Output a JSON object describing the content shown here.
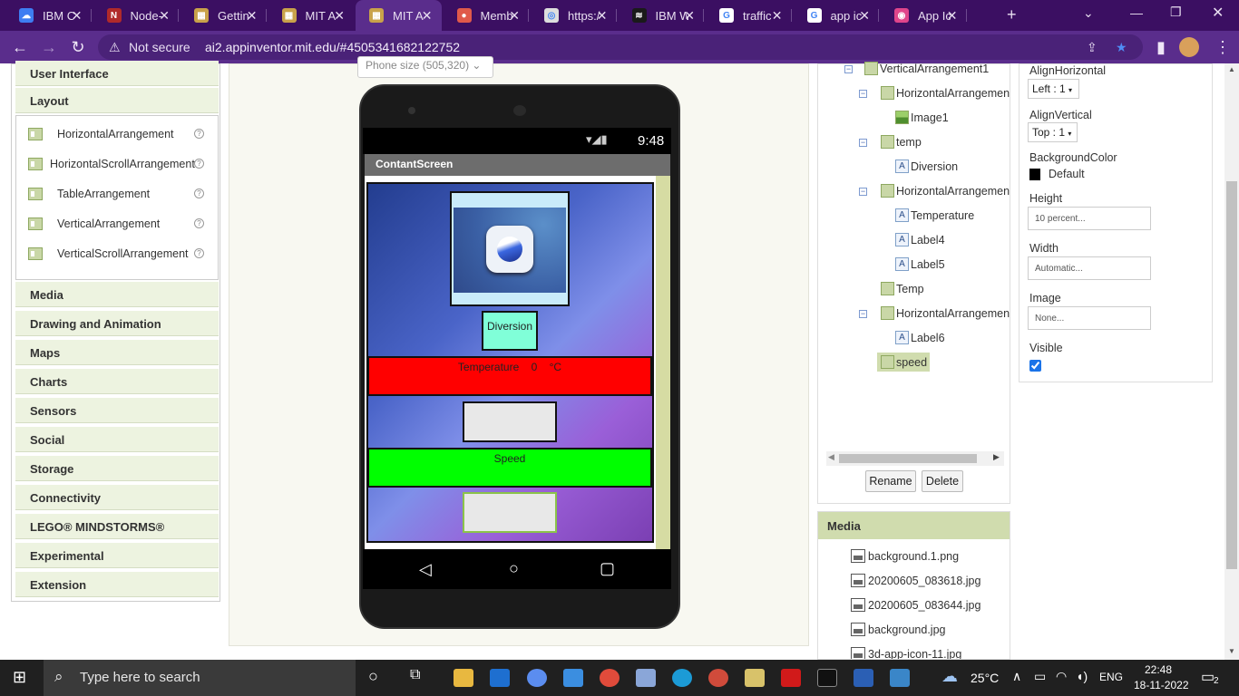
{
  "browser": {
    "tabs": [
      {
        "title": "IBM Cl",
        "fav_color": "#3e7df2",
        "fav_glyph": "☁"
      },
      {
        "title": "Node-",
        "fav_color": "#b02a2a",
        "fav_glyph": "N"
      },
      {
        "title": "Gettin",
        "fav_color": "#c9a24a",
        "fav_glyph": "▦"
      },
      {
        "title": "MIT A",
        "fav_color": "#c9a24a",
        "fav_glyph": "▦"
      },
      {
        "title": "MIT A",
        "fav_color": "#c9a24a",
        "fav_glyph": "▦"
      },
      {
        "title": "Memb",
        "fav_color": "#e05a4a",
        "fav_glyph": "●"
      },
      {
        "title": "https:/",
        "fav_color": "#dddddd",
        "fav_glyph": "◎"
      },
      {
        "title": "IBM W",
        "fav_color": "#1a1a1a",
        "fav_glyph": "≋"
      },
      {
        "title": "traffic",
        "fav_color": "#ffffff",
        "fav_glyph": "G"
      },
      {
        "title": "app ic",
        "fav_color": "#ffffff",
        "fav_glyph": "G"
      },
      {
        "title": "App Ic",
        "fav_color": "#e0458b",
        "fav_glyph": "◉"
      }
    ],
    "new_tab": "+",
    "not_secure": "Not secure",
    "url": "ai2.appinventor.mit.edu/#4505341682122752"
  },
  "palette": {
    "user_interface": "User Interface",
    "layout": "Layout",
    "layout_items": [
      "HorizontalArrangement",
      "HorizontalScrollArrangement",
      "TableArrangement",
      "VerticalArrangement",
      "VerticalScrollArrangement"
    ],
    "categories": [
      "Media",
      "Drawing and Animation",
      "Maps",
      "Charts",
      "Sensors",
      "Social",
      "Storage",
      "Connectivity",
      "LEGO® MINDSTORMS®",
      "Experimental",
      "Extension"
    ]
  },
  "viewer": {
    "phone_size": "Phone size (505,320)",
    "time": "9:48",
    "screen_title": "ContantScreen",
    "diversion_label": "Diversion",
    "temperature_text": "Temperature    0    °C",
    "speed_label": "Speed",
    "colors": {
      "temperature_bg": "#ff0000",
      "speed_bg": "#00ff00",
      "diversion_bg": "#80ffd8"
    }
  },
  "components": {
    "tree": [
      {
        "label": "VerticalArrangement1",
        "type": "container",
        "collapsible": true
      },
      {
        "label": "HorizontalArrangemen",
        "type": "container",
        "collapsible": true
      },
      {
        "label": "Image1",
        "type": "image",
        "collapsible": false
      },
      {
        "label": "temp",
        "type": "container",
        "collapsible": true
      },
      {
        "label": "Diversion",
        "type": "label",
        "collapsible": false
      },
      {
        "label": "HorizontalArrangemen",
        "type": "container",
        "collapsible": true
      },
      {
        "label": "Temperature",
        "type": "label",
        "collapsible": false
      },
      {
        "label": "Label4",
        "type": "label",
        "collapsible": false
      },
      {
        "label": "Label5",
        "type": "label",
        "collapsible": false
      },
      {
        "label": "Temp",
        "type": "container",
        "collapsible": false
      },
      {
        "label": "HorizontalArrangemen",
        "type": "container",
        "collapsible": true
      },
      {
        "label": "Label6",
        "type": "label",
        "collapsible": false
      },
      {
        "label": "speed",
        "type": "container",
        "collapsible": false,
        "selected": true
      }
    ],
    "rename": "Rename",
    "delete": "Delete"
  },
  "properties": {
    "align_horizontal_label": "AlignHorizontal",
    "align_horizontal_value": "Left : 1",
    "align_vertical_label": "AlignVertical",
    "align_vertical_value": "Top : 1",
    "background_color_label": "BackgroundColor",
    "background_color_value": "Default",
    "height_label": "Height",
    "height_value": "10 percent...",
    "width_label": "Width",
    "width_value": "Automatic...",
    "image_label": "Image",
    "image_value": "None...",
    "visible_label": "Visible",
    "visible_checked": true
  },
  "media": {
    "title": "Media",
    "files": [
      "background.1.png",
      "20200605_083618.jpg",
      "20200605_083644.jpg",
      "background.jpg",
      "3d-app-icon-11.jpg"
    ]
  },
  "taskbar": {
    "search_placeholder": "Type here to search",
    "weather": "25°C",
    "language": "ENG",
    "time": "22:48",
    "date": "18-11-2022",
    "notifications": "2"
  }
}
